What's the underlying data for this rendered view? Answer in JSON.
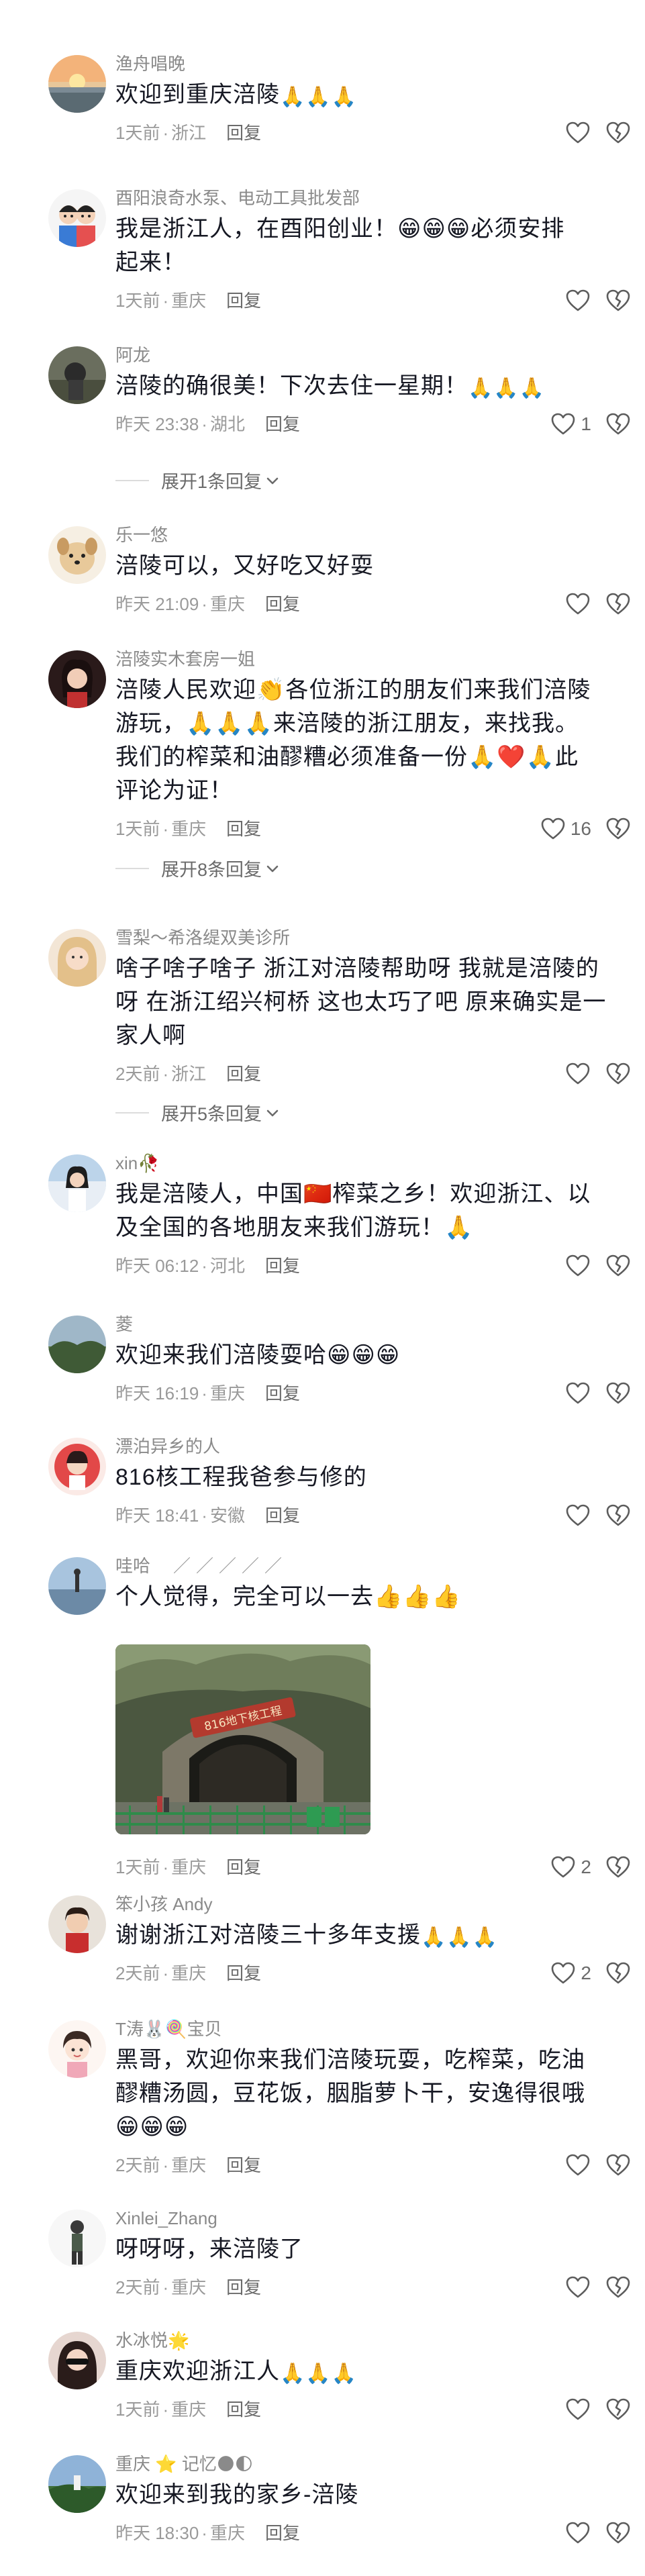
{
  "comments": [
    {
      "user": "渔舟唱晚",
      "text": "欢迎到重庆涪陵",
      "text_emoji": "🙏🙏🙏",
      "time": "1天前",
      "location": "浙江",
      "reply_label": "回复",
      "likes": ""
    },
    {
      "user": "酉阳浪奇水泵、电动工具批发部",
      "text_line1": "我是浙江人，在酉阳创业！😁😁😁必须安排",
      "text_line2": "起来！",
      "time": "1天前",
      "location": "重庆",
      "reply_label": "回复",
      "likes": ""
    },
    {
      "user": "阿龙",
      "text": "涪陵的确很美！下次去住一星期！",
      "text_emoji": "🙏🙏🙏",
      "time": "昨天 23:38",
      "location": "湖北",
      "reply_label": "回复",
      "likes": "1",
      "expand_label": "展开1条回复"
    },
    {
      "user": "乐一悠",
      "text": "涪陵可以，又好吃又好耍",
      "time": "昨天 21:09",
      "location": "重庆",
      "reply_label": "回复",
      "likes": ""
    },
    {
      "user": "涪陵实木套房一姐",
      "text_line1": "涪陵人民欢迎👏各位浙江的朋友们来我们涪陵",
      "text_line2": "游玩，🙏🙏🙏来涪陵的浙江朋友，来找我。",
      "text_line3": "我们的榨菜和油醪糟必须准备一份🙏❤️🙏此",
      "text_line4": "评论为证！",
      "time": "1天前",
      "location": "重庆",
      "reply_label": "回复",
      "likes": "16",
      "expand_label": "展开8条回复"
    },
    {
      "user": "雪梨～希洛缇双美诊所",
      "text_line1": "啥子啥子啥子 浙江对涪陵帮助呀 我就是涪陵的",
      "text_line2": "呀 在浙江绍兴柯桥 这也太巧了吧 原来确实是一",
      "text_line3": "家人啊",
      "time": "2天前",
      "location": "浙江",
      "reply_label": "回复",
      "likes": "",
      "expand_label": "展开5条回复"
    },
    {
      "user": "xin🥀",
      "text_line1": "我是涪陵人，中国🇨🇳榨菜之乡！欢迎浙江、以",
      "text_line2": "及全国的各地朋友来我们游玩！🙏",
      "time": "昨天 06:12",
      "location": "河北",
      "reply_label": "回复",
      "likes": ""
    },
    {
      "user": "菱",
      "text": "欢迎来我们涪陵耍哈😁😁😁",
      "time": "昨天 16:19",
      "location": "重庆",
      "reply_label": "回复",
      "likes": ""
    },
    {
      "user": "漂泊异乡的人",
      "text": "816核工程我爸参与修的",
      "time": "昨天 18:41",
      "location": "安徽",
      "reply_label": "回复",
      "likes": ""
    },
    {
      "user": "哇哈",
      "user_suffix": "／／／／／",
      "text": "个人觉得，完全可以一去👍👍👍",
      "photo_sign": "816地下核工程",
      "time": "1天前",
      "location": "重庆",
      "reply_label": "回复",
      "likes": "2"
    },
    {
      "user": "笨小孩 Andy",
      "text": "谢谢浙江对涪陵三十多年支援",
      "text_emoji": "🙏🙏🙏",
      "time": "2天前",
      "location": "重庆",
      "reply_label": "回复",
      "likes": "2"
    },
    {
      "user": "T涛🐰🍭宝贝",
      "text_line1": "黑哥，欢迎你来我们涪陵玩耍，吃榨菜，吃油",
      "text_line2": "醪糟汤圆，豆花饭，胭脂萝卜干，安逸得很哦",
      "text_line3": "😁😁😁",
      "time": "2天前",
      "location": "重庆",
      "reply_label": "回复",
      "likes": ""
    },
    {
      "user": "Xinlei_Zhang",
      "text": "呀呀呀，来涪陵了",
      "time": "2天前",
      "location": "重庆",
      "reply_label": "回复",
      "likes": ""
    },
    {
      "user": "水冰悦🌟",
      "text": "重庆欢迎浙江人",
      "text_emoji": "🙏🙏🙏",
      "time": "1天前",
      "location": "重庆",
      "reply_label": "回复",
      "likes": ""
    },
    {
      "user": "重庆 ⭐ 记忆🌑🌓",
      "text": "欢迎来到我的家乡-涪陵",
      "time": "昨天 18:30",
      "location": "重庆",
      "reply_label": "回复",
      "likes": ""
    }
  ],
  "separator": "·",
  "colors": {
    "text_primary": "#161823",
    "text_secondary": "#8a8a8a",
    "icon": "#5c5c5c",
    "divider": "#dcdcdc"
  }
}
